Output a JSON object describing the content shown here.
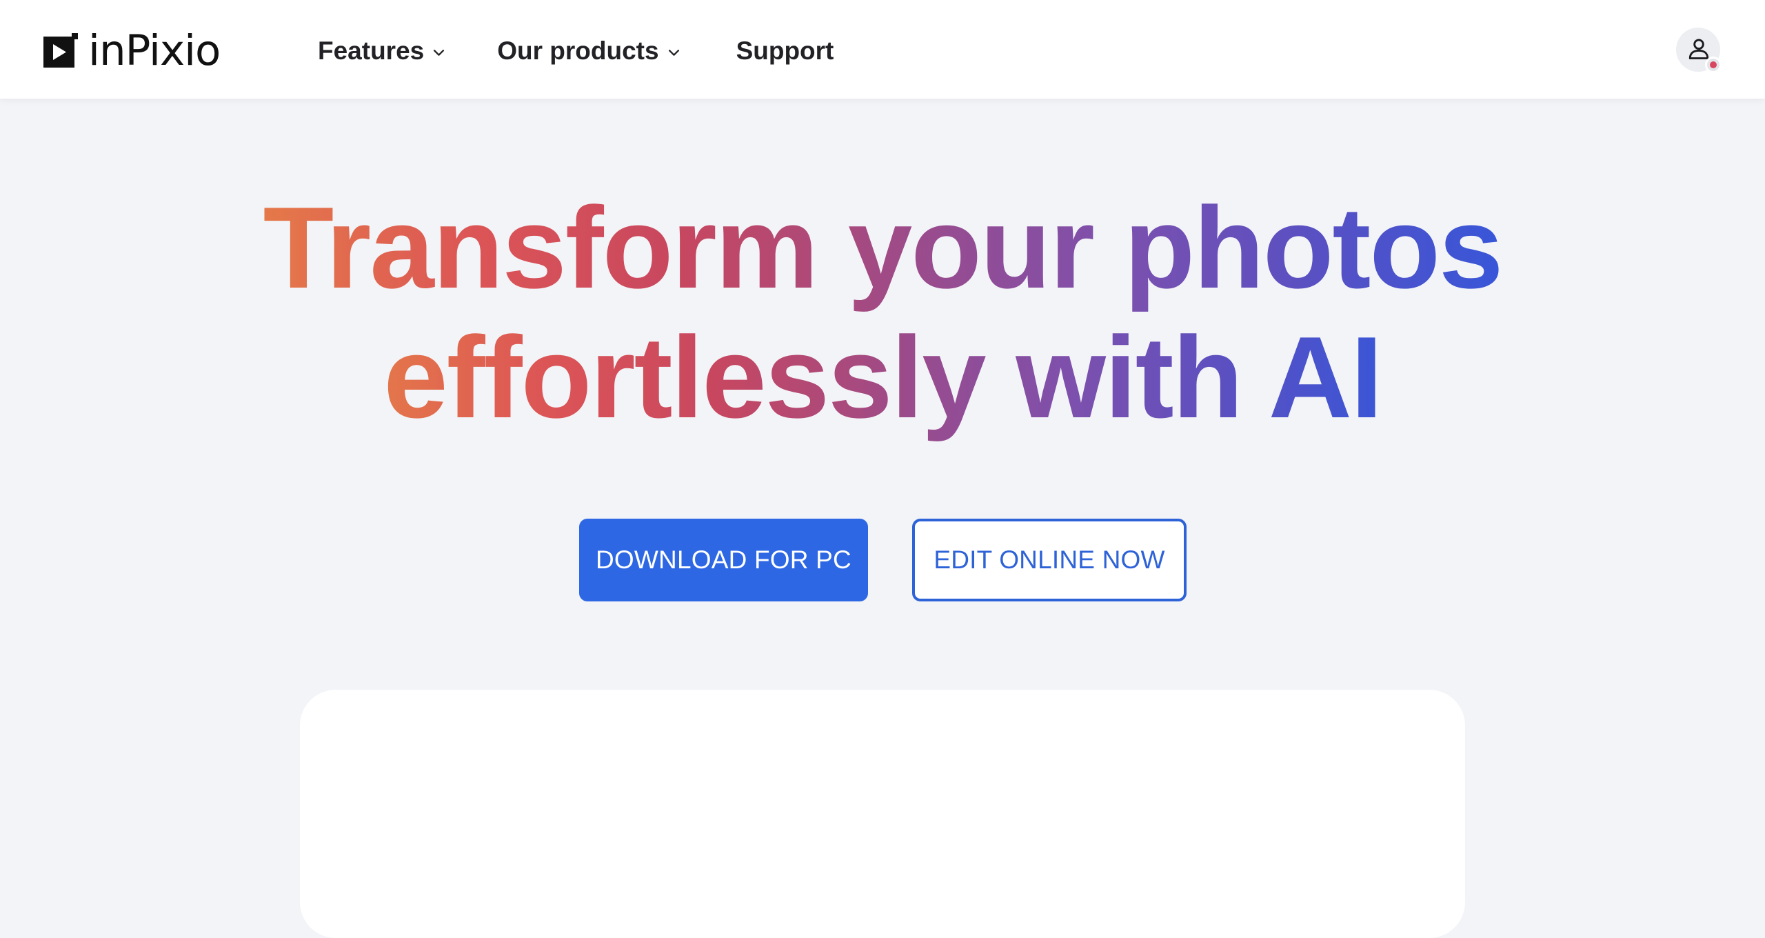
{
  "brand": {
    "name": "inPixio",
    "logo_icon": "play-icon"
  },
  "nav": {
    "items": [
      {
        "label": "Features",
        "has_dropdown": true
      },
      {
        "label": "Our products",
        "has_dropdown": true
      },
      {
        "label": "Support",
        "has_dropdown": false
      }
    ]
  },
  "account": {
    "icon": "user-icon",
    "status_color": "#d8475f"
  },
  "hero": {
    "headline_line1": "Transform your photos",
    "headline_line2": "effortlessly with AI",
    "gradient_colors": [
      "#e57c48",
      "#dc5556",
      "#c8475f",
      "#9c4b8a",
      "#7d50ad",
      "#5850c3",
      "#3457db"
    ],
    "primary_cta": "DOWNLOAD FOR PC",
    "secondary_cta": "EDIT ONLINE NOW"
  },
  "colors": {
    "accent": "#2e67e4",
    "page_background": "#f3f4f7",
    "header_background": "#ffffff",
    "text": "#222226"
  }
}
